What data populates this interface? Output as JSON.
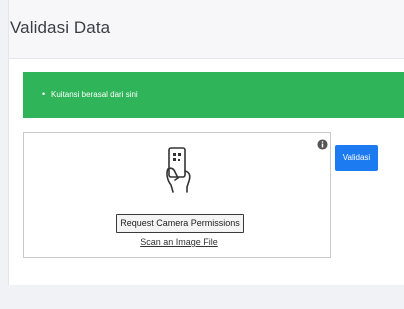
{
  "header": {
    "title": "Validasi Data"
  },
  "alert": {
    "items": [
      "Kuitansi berasal dari sini"
    ],
    "color": "#2fb45a"
  },
  "scanner": {
    "permission_button_label": "Request Camera Permissions",
    "scan_file_link": "Scan an Image File",
    "icons": [
      "info-icon",
      "phone-qr-scan-icon"
    ]
  },
  "actions": {
    "validate_label": "Validasi",
    "accent_color": "#1d7bf2"
  }
}
